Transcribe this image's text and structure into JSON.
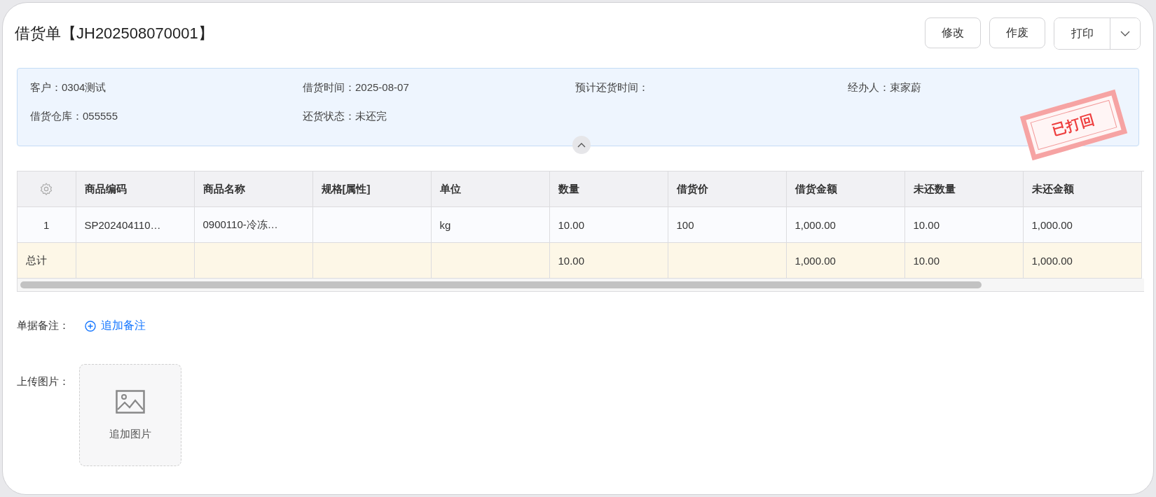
{
  "title": "借货单【JH202508070001】",
  "actions": [
    {
      "label": "修改",
      "kind": "button"
    },
    {
      "label": "作废",
      "kind": "button"
    },
    {
      "label": "打印",
      "kind": "split"
    }
  ],
  "info": [
    {
      "label": "客户：",
      "value": "0304测试"
    },
    {
      "label": "借货时间：",
      "value": "2025-08-07"
    },
    {
      "label": "预计还货时间："
    },
    {
      "label": "经办人：",
      "value": "束家蔚"
    },
    {
      "label": "借货仓库：",
      "value": "055555"
    },
    {
      "label": "还货状态：",
      "value": "未还完"
    }
  ],
  "stamp": {
    "text": "已打回"
  },
  "table": {
    "columns": [
      "",
      "商品编码",
      "商品名称",
      "规格[属性]",
      "单位",
      "数量",
      "借货价",
      "借货金额",
      "未还数量",
      "未还金额"
    ],
    "rows": [
      {
        "cells": [
          "1",
          "SP202404110…",
          "0900110-冷冻…",
          "",
          "kg",
          "10.00",
          "100",
          "1,000.00",
          "10.00",
          "1,000.00"
        ]
      }
    ],
    "total": {
      "cells": [
        "总计",
        "",
        "",
        "",
        "",
        "10.00",
        "",
        "1,000.00",
        "10.00",
        "1,000.00"
      ]
    }
  },
  "remark": {
    "label": "单据备注：",
    "link": "追加备注"
  },
  "upload": {
    "label": "上传图片：",
    "button": "追加图片"
  }
}
